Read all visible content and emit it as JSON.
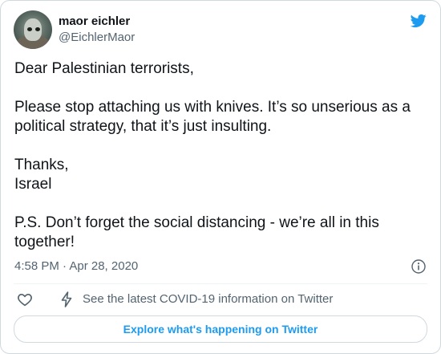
{
  "tweet": {
    "author_name": "maor eichler",
    "author_handle": "@EichlerMaor",
    "text_lines": [
      "Dear Palestinian terrorists,",
      "Please stop attaching us with knives. It’s so unserious as a political strategy, that it’s just insulting.",
      "Thanks,",
      "Israel",
      "P.S. Don’t forget the social distancing - we’re all in this together!"
    ],
    "timestamp": "4:58 PM · Apr 28, 2020"
  },
  "actions": {
    "covid_label": "See the latest COVID-19 information on Twitter",
    "explore_label": "Explore what's happening on Twitter"
  },
  "icons": {
    "brand": "twitter-bird-icon",
    "info": "info-icon",
    "like": "heart-icon",
    "covid": "lightning-bolt-icon"
  },
  "colors": {
    "accent": "#1d9bf0",
    "text": "#0f1419",
    "secondary": "#536471",
    "border": "#cfd9de"
  }
}
